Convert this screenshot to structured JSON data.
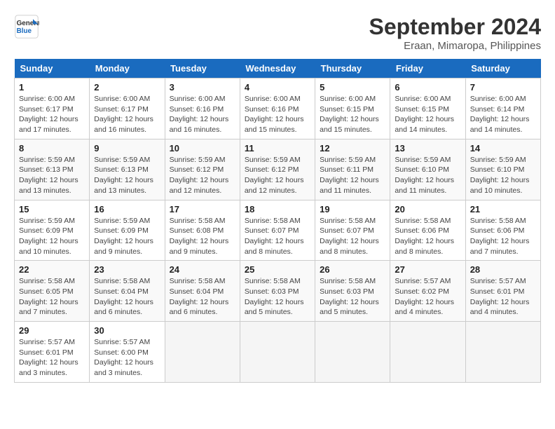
{
  "header": {
    "logo_line1": "General",
    "logo_line2": "Blue",
    "month": "September 2024",
    "location": "Eraan, Mimaropa, Philippines"
  },
  "weekdays": [
    "Sunday",
    "Monday",
    "Tuesday",
    "Wednesday",
    "Thursday",
    "Friday",
    "Saturday"
  ],
  "weeks": [
    [
      {
        "day": "1",
        "info": "Sunrise: 6:00 AM\nSunset: 6:17 PM\nDaylight: 12 hours\nand 17 minutes."
      },
      {
        "day": "2",
        "info": "Sunrise: 6:00 AM\nSunset: 6:17 PM\nDaylight: 12 hours\nand 16 minutes."
      },
      {
        "day": "3",
        "info": "Sunrise: 6:00 AM\nSunset: 6:16 PM\nDaylight: 12 hours\nand 16 minutes."
      },
      {
        "day": "4",
        "info": "Sunrise: 6:00 AM\nSunset: 6:16 PM\nDaylight: 12 hours\nand 15 minutes."
      },
      {
        "day": "5",
        "info": "Sunrise: 6:00 AM\nSunset: 6:15 PM\nDaylight: 12 hours\nand 15 minutes."
      },
      {
        "day": "6",
        "info": "Sunrise: 6:00 AM\nSunset: 6:15 PM\nDaylight: 12 hours\nand 14 minutes."
      },
      {
        "day": "7",
        "info": "Sunrise: 6:00 AM\nSunset: 6:14 PM\nDaylight: 12 hours\nand 14 minutes."
      }
    ],
    [
      {
        "day": "8",
        "info": "Sunrise: 5:59 AM\nSunset: 6:13 PM\nDaylight: 12 hours\nand 13 minutes."
      },
      {
        "day": "9",
        "info": "Sunrise: 5:59 AM\nSunset: 6:13 PM\nDaylight: 12 hours\nand 13 minutes."
      },
      {
        "day": "10",
        "info": "Sunrise: 5:59 AM\nSunset: 6:12 PM\nDaylight: 12 hours\nand 12 minutes."
      },
      {
        "day": "11",
        "info": "Sunrise: 5:59 AM\nSunset: 6:12 PM\nDaylight: 12 hours\nand 12 minutes."
      },
      {
        "day": "12",
        "info": "Sunrise: 5:59 AM\nSunset: 6:11 PM\nDaylight: 12 hours\nand 11 minutes."
      },
      {
        "day": "13",
        "info": "Sunrise: 5:59 AM\nSunset: 6:10 PM\nDaylight: 12 hours\nand 11 minutes."
      },
      {
        "day": "14",
        "info": "Sunrise: 5:59 AM\nSunset: 6:10 PM\nDaylight: 12 hours\nand 10 minutes."
      }
    ],
    [
      {
        "day": "15",
        "info": "Sunrise: 5:59 AM\nSunset: 6:09 PM\nDaylight: 12 hours\nand 10 minutes."
      },
      {
        "day": "16",
        "info": "Sunrise: 5:59 AM\nSunset: 6:09 PM\nDaylight: 12 hours\nand 9 minutes."
      },
      {
        "day": "17",
        "info": "Sunrise: 5:58 AM\nSunset: 6:08 PM\nDaylight: 12 hours\nand 9 minutes."
      },
      {
        "day": "18",
        "info": "Sunrise: 5:58 AM\nSunset: 6:07 PM\nDaylight: 12 hours\nand 8 minutes."
      },
      {
        "day": "19",
        "info": "Sunrise: 5:58 AM\nSunset: 6:07 PM\nDaylight: 12 hours\nand 8 minutes."
      },
      {
        "day": "20",
        "info": "Sunrise: 5:58 AM\nSunset: 6:06 PM\nDaylight: 12 hours\nand 8 minutes."
      },
      {
        "day": "21",
        "info": "Sunrise: 5:58 AM\nSunset: 6:06 PM\nDaylight: 12 hours\nand 7 minutes."
      }
    ],
    [
      {
        "day": "22",
        "info": "Sunrise: 5:58 AM\nSunset: 6:05 PM\nDaylight: 12 hours\nand 7 minutes."
      },
      {
        "day": "23",
        "info": "Sunrise: 5:58 AM\nSunset: 6:04 PM\nDaylight: 12 hours\nand 6 minutes."
      },
      {
        "day": "24",
        "info": "Sunrise: 5:58 AM\nSunset: 6:04 PM\nDaylight: 12 hours\nand 6 minutes."
      },
      {
        "day": "25",
        "info": "Sunrise: 5:58 AM\nSunset: 6:03 PM\nDaylight: 12 hours\nand 5 minutes."
      },
      {
        "day": "26",
        "info": "Sunrise: 5:58 AM\nSunset: 6:03 PM\nDaylight: 12 hours\nand 5 minutes."
      },
      {
        "day": "27",
        "info": "Sunrise: 5:57 AM\nSunset: 6:02 PM\nDaylight: 12 hours\nand 4 minutes."
      },
      {
        "day": "28",
        "info": "Sunrise: 5:57 AM\nSunset: 6:01 PM\nDaylight: 12 hours\nand 4 minutes."
      }
    ],
    [
      {
        "day": "29",
        "info": "Sunrise: 5:57 AM\nSunset: 6:01 PM\nDaylight: 12 hours\nand 3 minutes."
      },
      {
        "day": "30",
        "info": "Sunrise: 5:57 AM\nSunset: 6:00 PM\nDaylight: 12 hours\nand 3 minutes."
      },
      {
        "day": "",
        "info": ""
      },
      {
        "day": "",
        "info": ""
      },
      {
        "day": "",
        "info": ""
      },
      {
        "day": "",
        "info": ""
      },
      {
        "day": "",
        "info": ""
      }
    ]
  ]
}
